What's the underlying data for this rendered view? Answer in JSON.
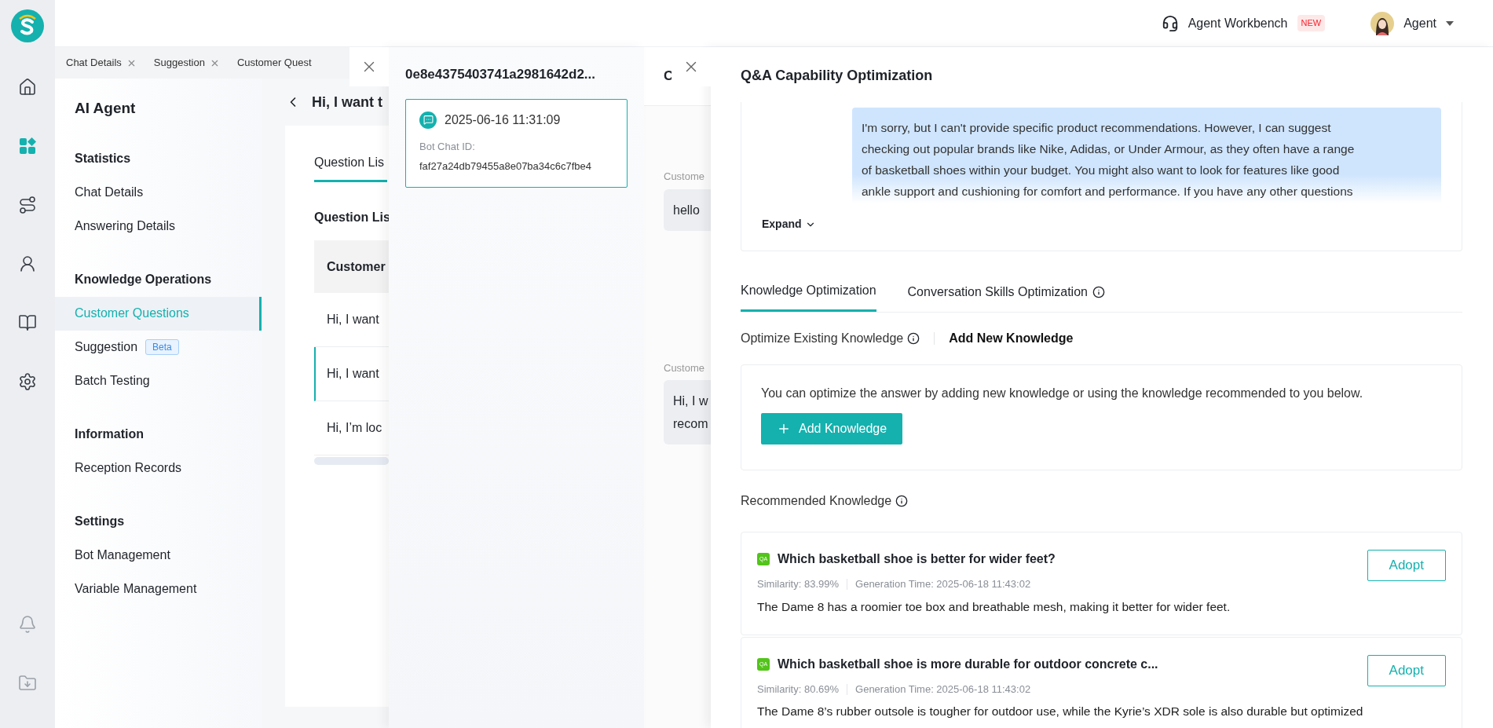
{
  "topbar": {
    "workbench": {
      "label": "Agent Workbench",
      "badge": "NEW"
    },
    "user": {
      "name": "Agent"
    }
  },
  "rail": {
    "items": [
      {
        "kind": "home",
        "selected": false
      },
      {
        "kind": "apps",
        "selected": true
      },
      {
        "kind": "route",
        "selected": false
      },
      {
        "kind": "person",
        "selected": false
      },
      {
        "kind": "book",
        "selected": false
      },
      {
        "kind": "settings",
        "selected": false
      }
    ],
    "bottom": [
      {
        "kind": "bell"
      },
      {
        "kind": "download"
      }
    ]
  },
  "page_tabs": [
    {
      "label": "Chat Details",
      "closable": true
    },
    {
      "label": "Suggestion",
      "closable": true
    },
    {
      "label": "Customer Quest",
      "closable": false
    }
  ],
  "sidebar": {
    "title": "AI Agent",
    "groups": [
      {
        "heading": "Statistics",
        "items": [
          {
            "label": "Chat Details",
            "selected": false
          },
          {
            "label": "Answering Details",
            "selected": false
          }
        ]
      },
      {
        "heading": "Knowledge Operations",
        "items": [
          {
            "label": "Customer Questions",
            "selected": true
          },
          {
            "label": "Suggestion",
            "selected": false,
            "badge": "Beta"
          },
          {
            "label": "Batch Testing",
            "selected": false
          }
        ]
      },
      {
        "heading": "Information",
        "items": [
          {
            "label": "Reception Records",
            "selected": false
          }
        ]
      },
      {
        "heading": "Settings",
        "items": [
          {
            "label": "Bot Management",
            "selected": false
          },
          {
            "label": "Variable Management",
            "selected": false
          }
        ]
      }
    ]
  },
  "main": {
    "title": "Hi, I want t",
    "tab": "Question Lis",
    "section_title": "Question Lis",
    "table": {
      "columns": [
        "Customer"
      ],
      "rows": [
        {
          "cells": [
            "Hi, I want"
          ],
          "selected": false
        },
        {
          "cells": [
            "Hi, I want"
          ],
          "selected": true
        },
        {
          "cells": [
            "Hi, I’m loc"
          ],
          "selected": false
        }
      ]
    }
  },
  "chat_record_drawer": {
    "title": "0e8e4375403741a2981642d2...",
    "records": [
      {
        "time": "2025-06-16 11:31:09",
        "id_label": "Bot Chat ID:",
        "id": "faf27a24db79455a8e07ba34c6c7fbe4",
        "selected": true
      }
    ]
  },
  "conversation_drawer": {
    "title": "C",
    "messages": [
      {
        "sender": "Custome",
        "lines": [
          "hello"
        ]
      },
      {
        "sender": "Custome",
        "lines": [
          "Hi, I w",
          "recom"
        ]
      }
    ]
  },
  "optimization_drawer": {
    "title": "Q&A Capability Optimization",
    "answer": {
      "lines": [
        "I'm sorry, but I can't provide specific product recommendations. However, I can suggest",
        "checking out popular brands like Nike, Adidas, or Under Armour, as they often have a range",
        "of basketball shoes within your budget. You might also want to look for features like good",
        "ankle support and cushioning for comfort and performance. If you have any other questions"
      ],
      "expand": "Expand"
    },
    "tabs": [
      {
        "label": "Knowledge Optimization",
        "selected": true,
        "info": false
      },
      {
        "label": "Conversation Skills Optimization",
        "selected": false,
        "info": true
      }
    ],
    "subtabs": [
      {
        "label": "Optimize Existing Knowledge",
        "selected": false,
        "info": true
      },
      {
        "label": "Add New Knowledge",
        "selected": true,
        "info": false
      }
    ],
    "hint": "You can optimize the answer by adding new knowledge or using the knowledge recommended to you below.",
    "add_button": "Add Knowledge",
    "recommended_title": "Recommended Knowledge",
    "knowledge": [
      {
        "tag": "QA",
        "title": "Which basketball shoe is better for wider feet?",
        "similarity": "Similarity: 83.99%",
        "generated": "Generation Time: 2025-06-18 11:43:02",
        "answer": "The Dame 8 has a roomier toe box and breathable mesh, making it better for wider feet.",
        "button": "Adopt"
      },
      {
        "tag": "QA",
        "title": "Which basketball shoe is more durable for outdoor concrete c...",
        "similarity": "Similarity: 80.69%",
        "generated": "Generation Time: 2025-06-18 11:43:02",
        "answer": "The Dame 8’s rubber outsole is tougher for outdoor use, while the Kyrie’s XDR sole is also durable but optimized",
        "button": "Adopt"
      }
    ]
  }
}
